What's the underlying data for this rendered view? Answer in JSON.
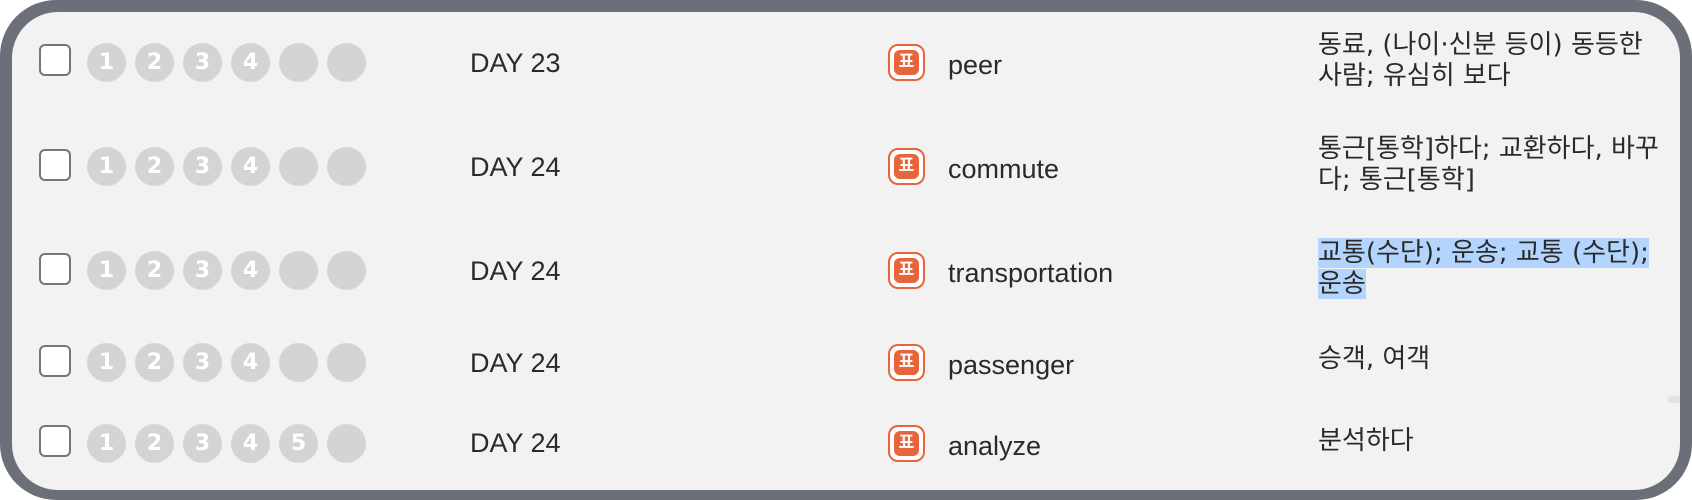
{
  "rows": [
    {
      "day": "DAY 23",
      "pos_icon": "표",
      "word": "peer",
      "meaning": "동료, (나이·신분 등이) 동등한 사람; 유심히 보다",
      "circles": [
        "1",
        "2",
        "3",
        "4",
        "",
        ""
      ]
    },
    {
      "day": "DAY 24",
      "pos_icon": "표",
      "word": "commute",
      "meaning": "통근[통학]하다; 교환하다, 바꾸다; 통근[통학]",
      "circles": [
        "1",
        "2",
        "3",
        "4",
        "",
        ""
      ]
    },
    {
      "day": "DAY 24",
      "pos_icon": "표",
      "word": "transportation",
      "meaning": "교통(수단); 운송; 교통 (수단); 운송",
      "circles": [
        "1",
        "2",
        "3",
        "4",
        "",
        ""
      ]
    },
    {
      "day": "DAY 24",
      "pos_icon": "표",
      "word": "passenger",
      "meaning": "승객, 여객",
      "circles": [
        "1",
        "2",
        "3",
        "4",
        "",
        ""
      ]
    },
    {
      "day": "DAY 24",
      "pos_icon": "표",
      "word": "analyze",
      "meaning": "분석하다",
      "circles": [
        "1",
        "2",
        "3",
        "4",
        "5",
        ""
      ]
    }
  ],
  "colors": {
    "frame": "#6b7078",
    "panel": "#f2f2f2",
    "circle": "#d4d4d4",
    "pos_accent": "#e8643a",
    "selection": "#b3d4fd"
  },
  "icons": {
    "checkbox": "checkbox-icon",
    "pos": "pos-badge-icon"
  }
}
